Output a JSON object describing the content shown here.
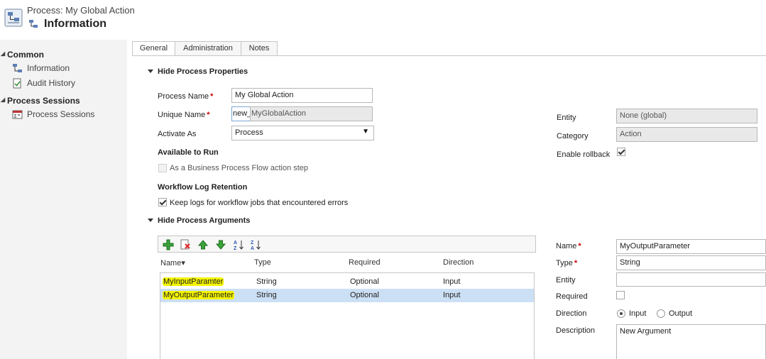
{
  "header": {
    "breadcrumb": "Process: My Global Action",
    "title": "Information"
  },
  "sidebar": {
    "sections": [
      {
        "label": "Common",
        "items": [
          "Information",
          "Audit History"
        ]
      },
      {
        "label": "Process Sessions",
        "items": [
          "Process Sessions"
        ]
      }
    ]
  },
  "tabs": [
    "General",
    "Administration",
    "Notes"
  ],
  "properties": {
    "section_title": "Hide Process Properties",
    "process_name_label": "Process Name",
    "process_name_value": "My Global Action",
    "unique_name_label": "Unique Name",
    "unique_name_prefix": "new_",
    "unique_name_value": "MyGlobalAction",
    "activate_as_label": "Activate As",
    "activate_as_value": "Process",
    "available_to_run_label": "Available to Run",
    "bpf_step_label": "As a Business Process Flow action step",
    "log_retention_label": "Workflow Log Retention",
    "keep_logs_label": "Keep logs for workflow jobs that encountered errors",
    "entity_label": "Entity",
    "entity_value": "None (global)",
    "category_label": "Category",
    "category_value": "Action",
    "rollback_label": "Enable rollback"
  },
  "arguments": {
    "section_title": "Hide Process Arguments",
    "columns": [
      "Name",
      "Type",
      "Required",
      "Direction"
    ],
    "rows": [
      {
        "name": "MyInputParamter",
        "type": "String",
        "required": "Optional",
        "direction": "Input"
      },
      {
        "name": "MyOutputParameter",
        "type": "String",
        "required": "Optional",
        "direction": "Input"
      }
    ]
  },
  "detail": {
    "name_label": "Name",
    "name_value": "MyOutputParameter",
    "type_label": "Type",
    "type_value": "String",
    "entity_label": "Entity",
    "entity_value": "",
    "required_label": "Required",
    "direction_label": "Direction",
    "direction_input": "Input",
    "direction_output": "Output",
    "description_label": "Description",
    "description_value": "New Argument"
  },
  "required_mark": "*",
  "sort_glyph": "▾",
  "select_arrow": "▼"
}
